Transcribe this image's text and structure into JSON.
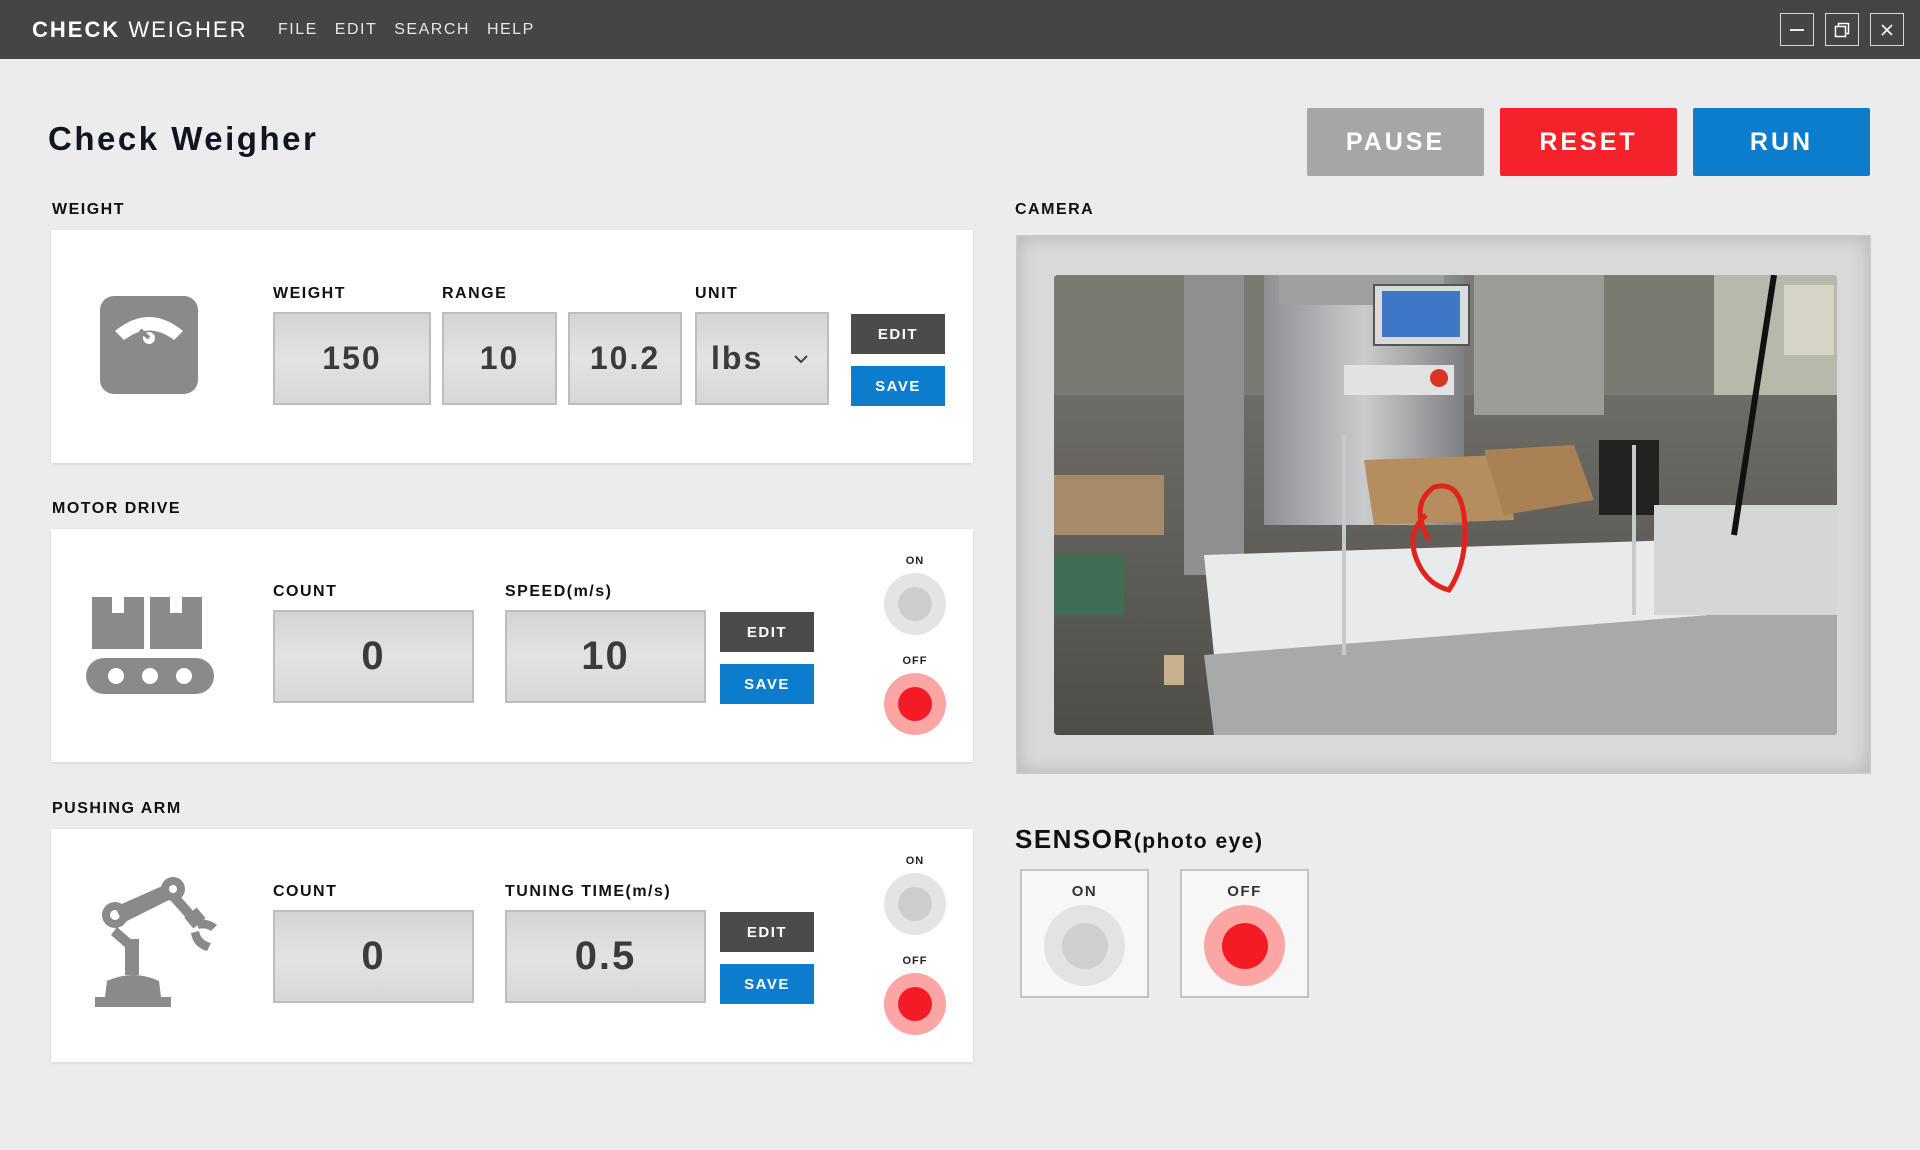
{
  "window": {
    "title_bold": "CHECK",
    "title_rest": " WEIGHER",
    "menu": [
      "FILE",
      "EDIT",
      "SEARCH",
      "HELP"
    ]
  },
  "page": {
    "title": "Check Weigher"
  },
  "controls": {
    "pause": "PAUSE",
    "reset": "RESET",
    "run": "RUN"
  },
  "weight_section": {
    "label": "WEIGHT",
    "weight_label": "WEIGHT",
    "weight_value": "150",
    "range_label": "RANGE",
    "range_value": "10",
    "range_value_2": "10.2",
    "unit_label": "UNIT",
    "unit_value": "lbs",
    "edit": "EDIT",
    "save": "SAVE"
  },
  "motor_section": {
    "label": "MOTOR DRIVE",
    "count_label": "COUNT",
    "count_value": "0",
    "speed_label": "SPEED(m/s)",
    "speed_value": "10",
    "edit": "EDIT",
    "save": "SAVE",
    "on_label": "ON",
    "off_label": "OFF"
  },
  "arm_section": {
    "label": "PUSHING ARM",
    "count_label": "COUNT",
    "count_value": "0",
    "tuning_label": "TUNING TIME(m/s)",
    "tuning_value": "0.5",
    "edit": "EDIT",
    "save": "SAVE",
    "on_label": "ON",
    "off_label": "OFF"
  },
  "camera": {
    "label": "CAMERA"
  },
  "sensor": {
    "title": "SENSOR",
    "subtitle": "(photo eye)",
    "on_label": "ON",
    "off_label": "OFF"
  },
  "colors": {
    "titlebar": "#454545",
    "pause": "#a6a6a6",
    "reset": "#f52329",
    "run": "#0c7ccd",
    "save": "#0c7ccd",
    "edit": "#4b4b4b",
    "active_red": "#f51b24"
  },
  "icons": {
    "window": [
      "minimize-icon",
      "restore-icon",
      "close-icon"
    ],
    "weight": "scale-icon",
    "motor": "conveyor-icon",
    "arm": "robot-arm-icon",
    "unit_dropdown": "chevron-down-icon"
  }
}
